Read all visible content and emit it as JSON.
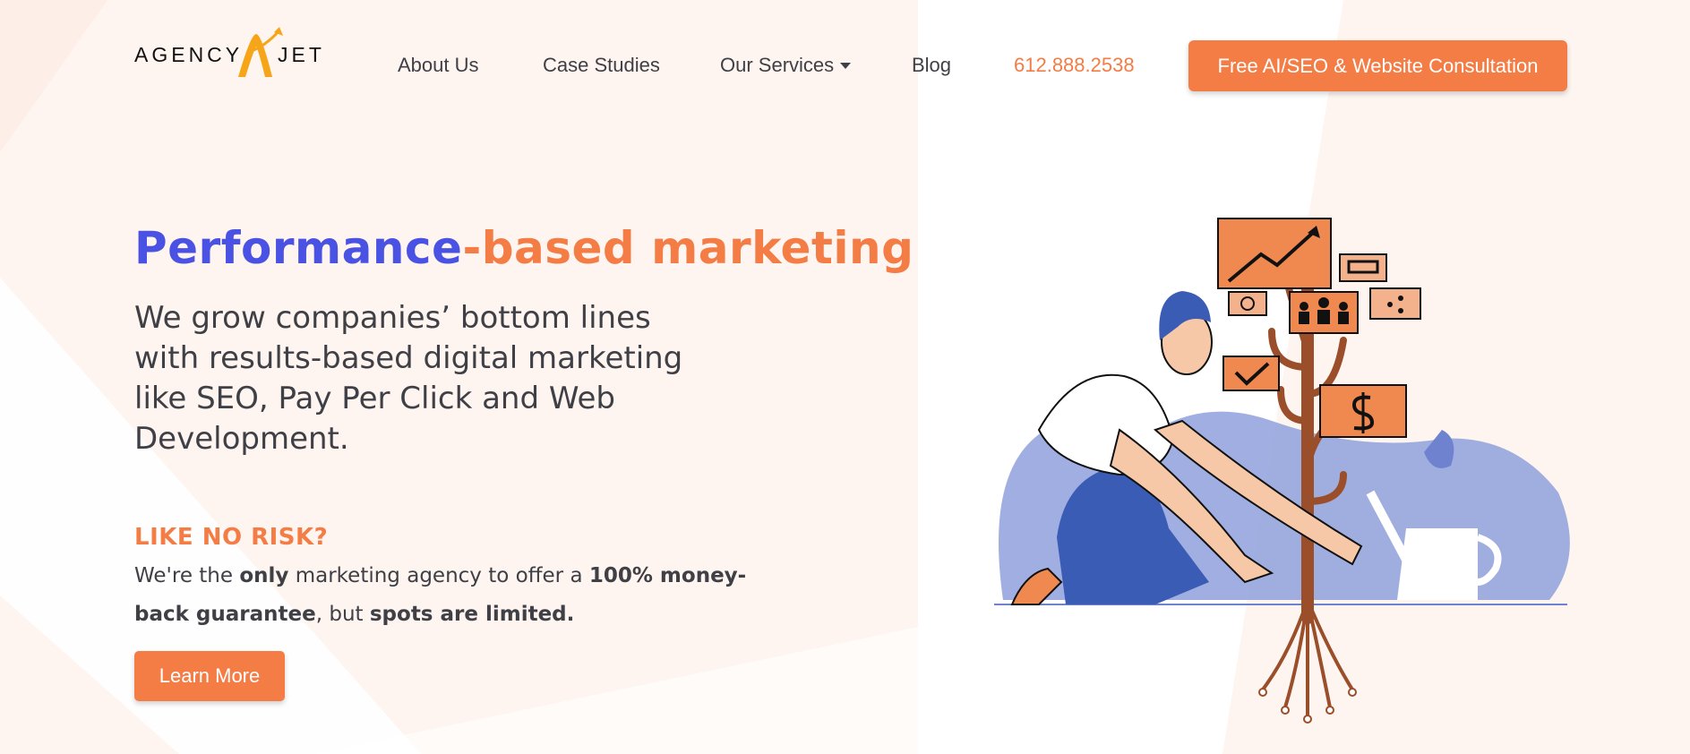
{
  "colors": {
    "accent": "#f47c45",
    "headline_blue": "#4a52e3",
    "text": "#3f3f46",
    "background_tint": "#fef4f0"
  },
  "header": {
    "logo": {
      "word_left": "AGENCY",
      "word_right": "JET",
      "icon": "jet-arrow-icon"
    },
    "nav": {
      "about": "About Us",
      "cases": "Case Studies",
      "services": "Our Services",
      "blog": "Blog",
      "phone": "612.888.2538"
    },
    "cta_label": "Free AI/SEO & Website Consultation"
  },
  "hero": {
    "headline_part1": "Performance",
    "headline_part2": "-based marketing",
    "subhead": "We grow companies’ bottom lines with results-based digital marketing like SEO, Pay Per Click and Web Development.",
    "risk_title": "LIKE NO RISK?",
    "risk_text": {
      "t1": "We're the ",
      "b1": "only",
      "t2": " marketing agency to offer a ",
      "b2": "100% money-back guarantee",
      "t3": ", but ",
      "b3": "spots are limited."
    },
    "learn_more": "Learn More"
  },
  "illustration": {
    "icons": [
      "growth-chart-icon",
      "chat-icon",
      "smiley-icon",
      "team-icon",
      "share-icon",
      "checkmark-icon",
      "dollar-icon",
      "watering-can-icon"
    ]
  }
}
